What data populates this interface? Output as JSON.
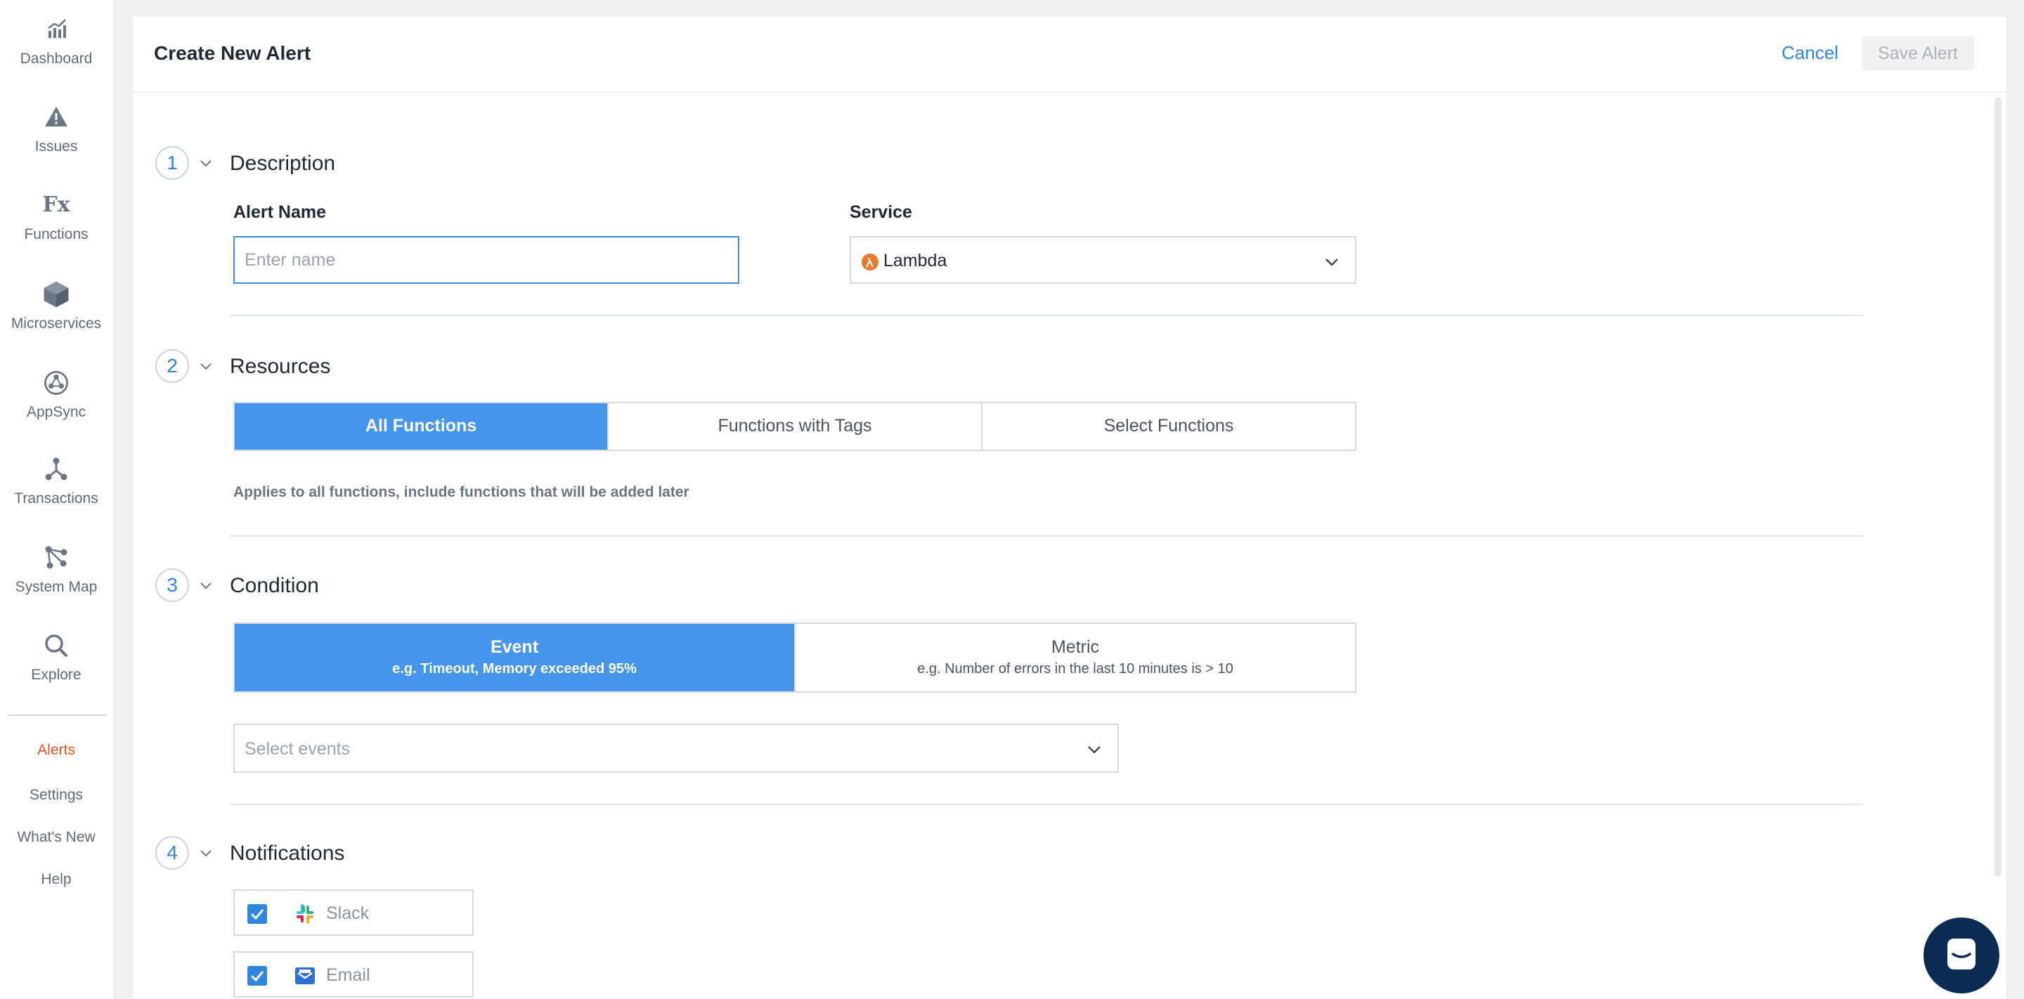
{
  "sidebar": {
    "items": [
      {
        "label": "Dashboard",
        "icon": "bar-chart-icon"
      },
      {
        "label": "Issues",
        "icon": "warning-icon"
      },
      {
        "label": "Functions",
        "icon": "fx-icon"
      },
      {
        "label": "Microservices",
        "icon": "cube-icon"
      },
      {
        "label": "AppSync",
        "icon": "appsync-icon"
      },
      {
        "label": "Transactions",
        "icon": "transactions-icon"
      },
      {
        "label": "System Map",
        "icon": "system-map-icon"
      },
      {
        "label": "Explore",
        "icon": "search-icon"
      }
    ],
    "fx_glyph": "Fx",
    "links": [
      "Alerts",
      "Settings",
      "What's New",
      "Help"
    ],
    "active_link": "Alerts"
  },
  "header": {
    "title": "Create New Alert",
    "cancel_label": "Cancel",
    "save_label": "Save Alert"
  },
  "sections": {
    "description": {
      "number": "1",
      "title": "Description",
      "alert_name_label": "Alert Name",
      "alert_name_placeholder": "Enter name",
      "alert_name_value": "",
      "service_label": "Service",
      "service_value": "Lambda"
    },
    "resources": {
      "number": "2",
      "title": "Resources",
      "options": [
        "All Functions",
        "Functions with Tags",
        "Select Functions"
      ],
      "selected": "All Functions",
      "helper": "Applies to all functions, include functions that will be added later"
    },
    "condition": {
      "number": "3",
      "title": "Condition",
      "options": [
        {
          "label": "Event",
          "sub": "e.g. Timeout, Memory exceeded 95%"
        },
        {
          "label": "Metric",
          "sub": "e.g. Number of errors in the last 10 minutes is > 10"
        }
      ],
      "selected": "Event",
      "events_placeholder": "Select events"
    },
    "notifications": {
      "number": "4",
      "title": "Notifications",
      "channels": [
        {
          "label": "Slack",
          "checked": true,
          "icon": "slack-icon"
        },
        {
          "label": "Email",
          "checked": true,
          "icon": "email-icon"
        }
      ]
    }
  },
  "colors": {
    "accent": "#4596ea",
    "link": "#2d87e2",
    "active_nav": "#e8531f",
    "lambda": "#e8792b"
  }
}
